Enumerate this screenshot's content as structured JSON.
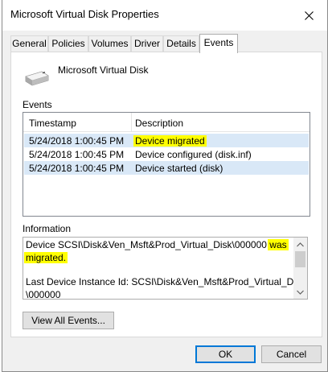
{
  "window": {
    "title": "Microsoft Virtual Disk Properties"
  },
  "tabs": [
    {
      "label": "General"
    },
    {
      "label": "Policies"
    },
    {
      "label": "Volumes"
    },
    {
      "label": "Driver"
    },
    {
      "label": "Details"
    },
    {
      "label": "Events",
      "active": true
    }
  ],
  "device": {
    "name": "Microsoft Virtual Disk",
    "icon": "disk-drive-icon"
  },
  "events": {
    "label": "Events",
    "columns": [
      "Timestamp",
      "Description"
    ],
    "rows": [
      {
        "timestamp": "5/24/2018 1:00:45 PM",
        "description": "Device migrated",
        "selected": true,
        "highlighted": true
      },
      {
        "timestamp": "5/24/2018 1:00:45 PM",
        "description": "Device configured (disk.inf)"
      },
      {
        "timestamp": "5/24/2018 1:00:45 PM",
        "description": "Device started (disk)"
      }
    ]
  },
  "information": {
    "label": "Information",
    "line1": "Device SCSI\\Disk&Ven_Msft&Prod_Virtual_Disk\\000000",
    "line1_highlight": "was",
    "line2_highlight": "migrated.",
    "line3": "Last Device Instance Id: SCSI\\Disk&Ven_Msft&Prod_Virtual_Disk",
    "line4": "\\000000"
  },
  "buttons": {
    "view_all": "View All Events...",
    "ok": "OK",
    "cancel": "Cancel"
  },
  "colors": {
    "highlight": "#ffff00",
    "selected_row": "#d9e8f7",
    "accent": "#0078d7"
  }
}
